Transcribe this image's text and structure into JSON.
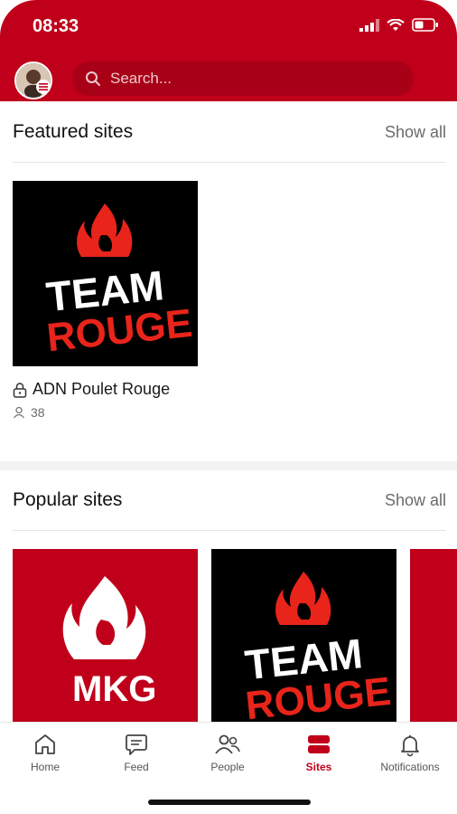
{
  "status": {
    "time": "08:33"
  },
  "search": {
    "placeholder": "Search..."
  },
  "featured": {
    "title": "Featured sites",
    "show_all": "Show all",
    "card": {
      "logo_line1": "TEAM",
      "logo_line2": "ROUGE",
      "name": "ADN Poulet Rouge",
      "members": "38"
    }
  },
  "popular": {
    "title": "Popular sites",
    "show_all": "Show all",
    "cards": [
      {
        "logo_text": "MKG"
      },
      {
        "logo_line1": "TEAM",
        "logo_line2": "ROUGE"
      }
    ]
  },
  "nav": {
    "items": [
      {
        "label": "Home"
      },
      {
        "label": "Feed"
      },
      {
        "label": "People"
      },
      {
        "label": "Sites"
      },
      {
        "label": "Notifications"
      }
    ]
  },
  "colors": {
    "brand": "#c0001a",
    "search_bg": "#a80016"
  }
}
